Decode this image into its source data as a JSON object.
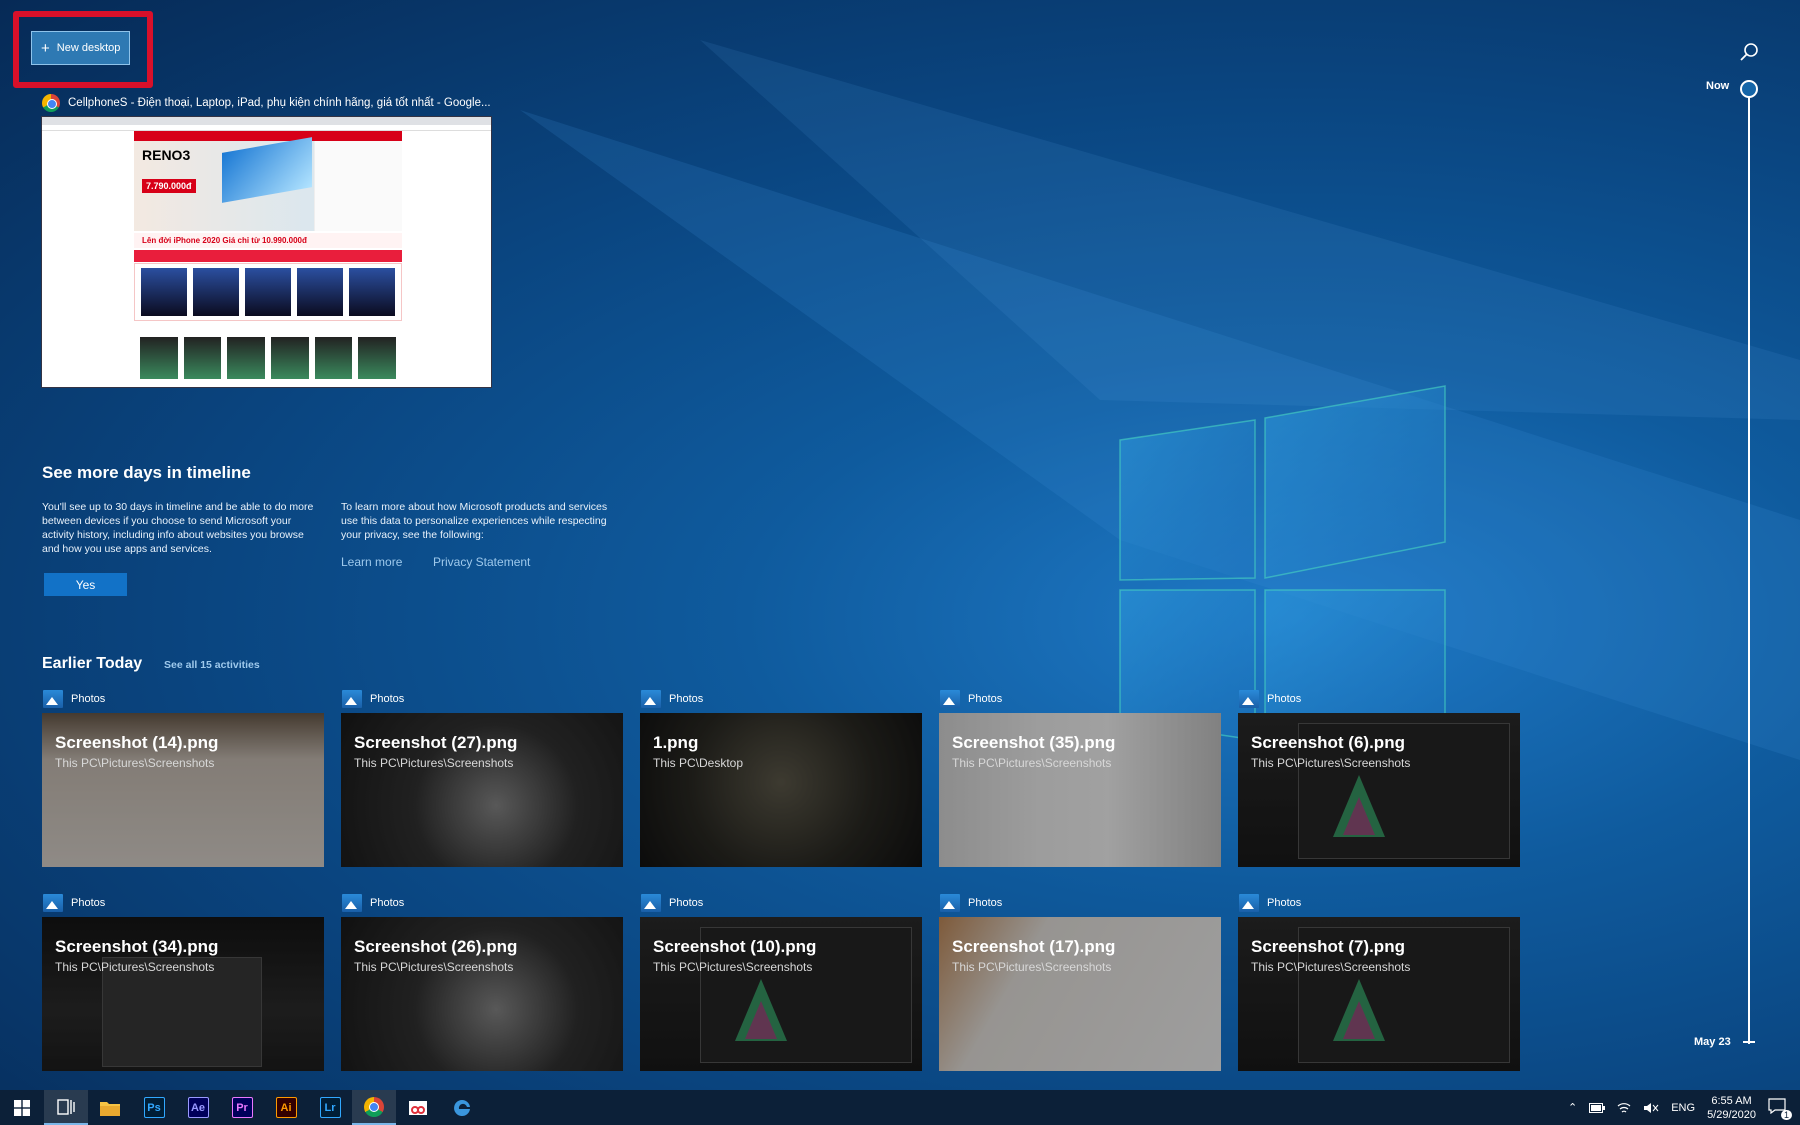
{
  "new_desktop": {
    "label": "New desktop",
    "icon": "plus-icon"
  },
  "active_window": {
    "title": "CellphoneS - Điện thoại, Laptop, iPad, phụ kiện chính hãng, giá tốt nhất - Google...",
    "app_icon": "chrome-icon",
    "thumb": {
      "banner_title": "RENO3",
      "price": "7.790.000đ",
      "promo": "Lên đời iPhone 2020   Giá chỉ từ 10.990.000đ"
    }
  },
  "timeline_prompt": {
    "title": "See more days in timeline",
    "body_left": "You'll see up to 30 days in timeline and be able to do more between devices if you choose to send Microsoft your activity history, including info about websites you browse and how you use apps and services.",
    "body_right": "To learn more about how Microsoft products and services use this data to personalize experiences while respecting your privacy, see the following:",
    "learn_more": "Learn more",
    "privacy": "Privacy Statement",
    "yes": "Yes"
  },
  "earlier_today": {
    "title": "Earlier Today",
    "see_all": "See all 15 activities",
    "cards": [
      {
        "app": "Photos",
        "name": "Screenshot (14).png",
        "path": "This PC\\Pictures\\Screenshots"
      },
      {
        "app": "Photos",
        "name": "Screenshot (27).png",
        "path": "This PC\\Pictures\\Screenshots"
      },
      {
        "app": "Photos",
        "name": "1.png",
        "path": "This PC\\Desktop"
      },
      {
        "app": "Photos",
        "name": "Screenshot (35).png",
        "path": "This PC\\Pictures\\Screenshots"
      },
      {
        "app": "Photos",
        "name": "Screenshot (6).png",
        "path": "This PC\\Pictures\\Screenshots"
      },
      {
        "app": "Photos",
        "name": "Screenshot (34).png",
        "path": "This PC\\Pictures\\Screenshots"
      },
      {
        "app": "Photos",
        "name": "Screenshot (26).png",
        "path": "This PC\\Pictures\\Screenshots"
      },
      {
        "app": "Photos",
        "name": "Screenshot (10).png",
        "path": "This PC\\Pictures\\Screenshots"
      },
      {
        "app": "Photos",
        "name": "Screenshot (17).png",
        "path": "This PC\\Pictures\\Screenshots"
      },
      {
        "app": "Photos",
        "name": "Screenshot (7).png",
        "path": "This PC\\Pictures\\Screenshots"
      }
    ]
  },
  "timeline": {
    "now": "Now",
    "date": "May 23",
    "search_icon": "search-icon"
  },
  "taskbar": {
    "apps": [
      {
        "icon": "windows-start-icon"
      },
      {
        "icon": "task-view-icon"
      },
      {
        "icon": "file-explorer-icon"
      },
      {
        "icon": "photoshop-icon",
        "label": "Ps",
        "color": "#31a8ff",
        "bg": "#001e36"
      },
      {
        "icon": "after-effects-icon",
        "label": "Ae",
        "color": "#9999ff",
        "bg": "#00005b"
      },
      {
        "icon": "premiere-icon",
        "label": "Pr",
        "color": "#ea77ff",
        "bg": "#00005b"
      },
      {
        "icon": "illustrator-icon",
        "label": "Ai",
        "color": "#ff9a00",
        "bg": "#330000"
      },
      {
        "icon": "lightroom-icon",
        "label": "Lr",
        "color": "#31a8ff",
        "bg": "#001e36"
      },
      {
        "icon": "chrome-icon"
      },
      {
        "icon": "snipping-tool-icon"
      },
      {
        "icon": "edge-icon"
      }
    ],
    "tray": {
      "language": "ENG",
      "time": "6:55 AM",
      "date": "5/29/2020",
      "notification_count": "1"
    }
  }
}
